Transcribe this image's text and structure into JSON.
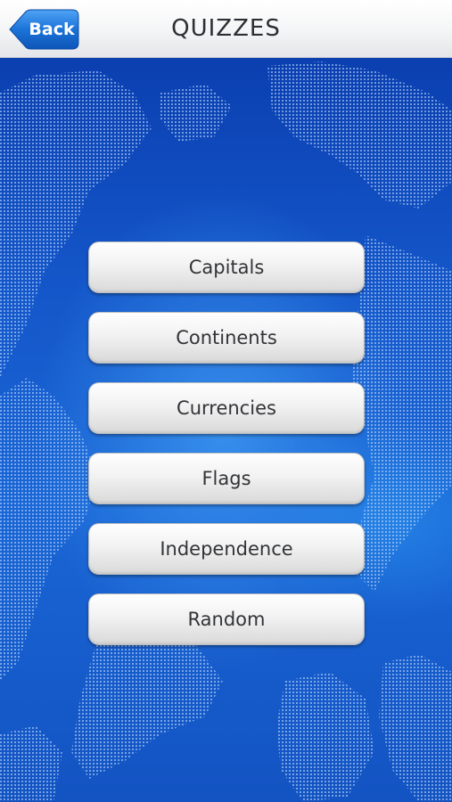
{
  "header": {
    "title": "QUIZZES",
    "back_label": "Back"
  },
  "menu": {
    "items": [
      {
        "label": "Capitals"
      },
      {
        "label": "Continents"
      },
      {
        "label": "Currencies"
      },
      {
        "label": "Flags"
      },
      {
        "label": "Independence"
      },
      {
        "label": "Random"
      }
    ]
  },
  "colors": {
    "background_blue": "#1456c9",
    "back_button_blue": "#1b73d8",
    "header_bg": "#f4f5f6",
    "button_text": "#333438"
  }
}
